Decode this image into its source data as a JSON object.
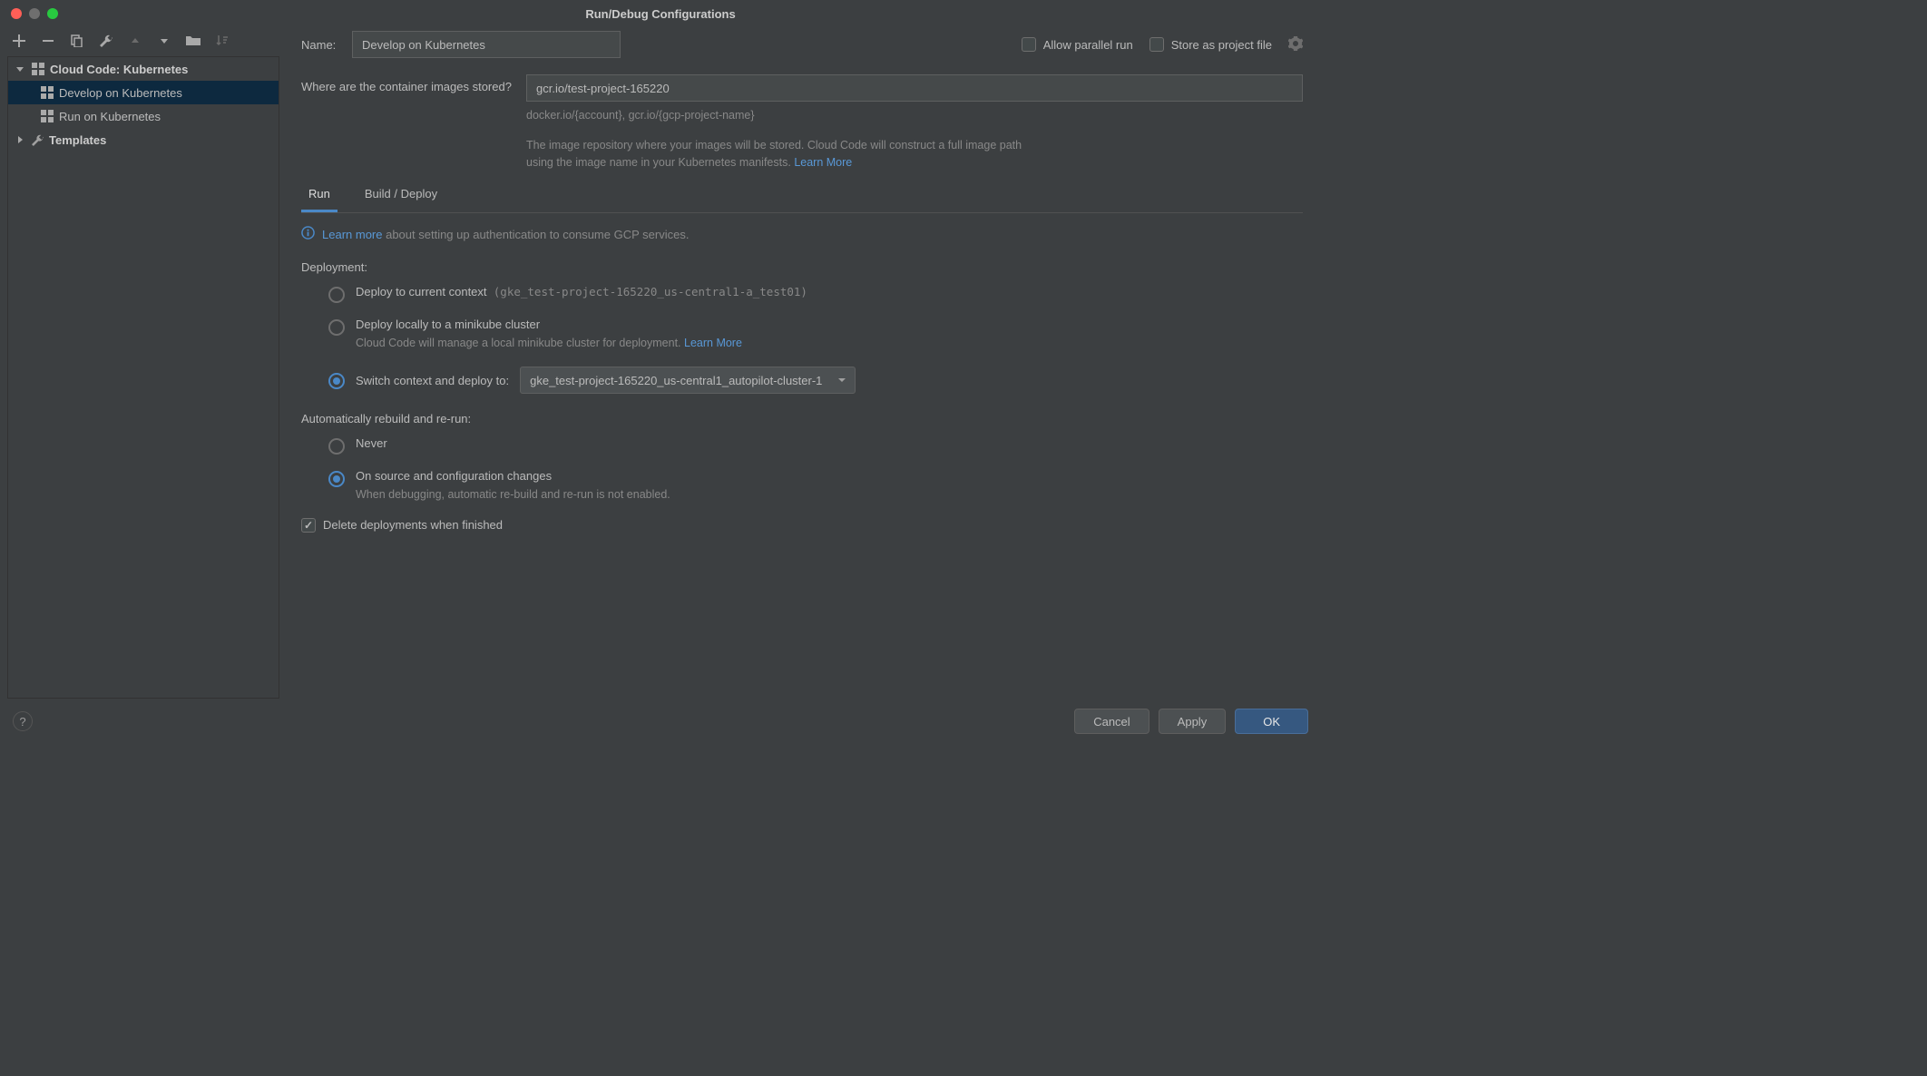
{
  "titlebar": {
    "title": "Run/Debug Configurations"
  },
  "sidebar": {
    "groups": [
      {
        "name": "Cloud Code: Kubernetes",
        "expanded": true,
        "children": [
          {
            "label": "Develop on Kubernetes",
            "selected": true
          },
          {
            "label": "Run on Kubernetes",
            "selected": false
          }
        ]
      },
      {
        "name": "Templates",
        "expanded": false,
        "children": []
      }
    ]
  },
  "form": {
    "name_label": "Name:",
    "name_value": "Develop on Kubernetes",
    "allow_parallel_label": "Allow parallel run",
    "store_project_label": "Store as project file",
    "image_question": "Where are the container images stored?",
    "image_value": "gcr.io/test-project-165220",
    "image_placeholder_hint": "docker.io/{account}, gcr.io/{gcp-project-name}",
    "image_help_text": "The image repository where your images will be stored. Cloud Code will construct a full image path using the image name in your Kubernetes manifests. ",
    "image_help_link": "Learn More",
    "tabs": [
      {
        "label": "Run",
        "active": true
      },
      {
        "label": "Build / Deploy",
        "active": false
      }
    ],
    "auth_learn_more": "Learn more",
    "auth_info_text": " about setting up authentication to consume GCP services.",
    "deployment_title": "Deployment:",
    "deploy_current_label": "Deploy to current context",
    "deploy_current_context": "(gke_test-project-165220_us-central1-a_test01)",
    "deploy_minikube_label": "Deploy locally to a minikube cluster",
    "deploy_minikube_hint": "Cloud Code will manage a local minikube cluster for deployment. ",
    "deploy_minikube_link": "Learn More",
    "deploy_switch_label": "Switch context and deploy to:",
    "deploy_switch_value": "gke_test-project-165220_us-central1_autopilot-cluster-1",
    "auto_title": "Automatically rebuild and re-run:",
    "auto_never": "Never",
    "auto_onsource": "On source and configuration changes",
    "auto_onsource_hint": "When debugging, automatic re-build and re-run is not enabled.",
    "delete_label": "Delete deployments when finished"
  },
  "footer": {
    "cancel": "Cancel",
    "apply": "Apply",
    "ok": "OK"
  }
}
